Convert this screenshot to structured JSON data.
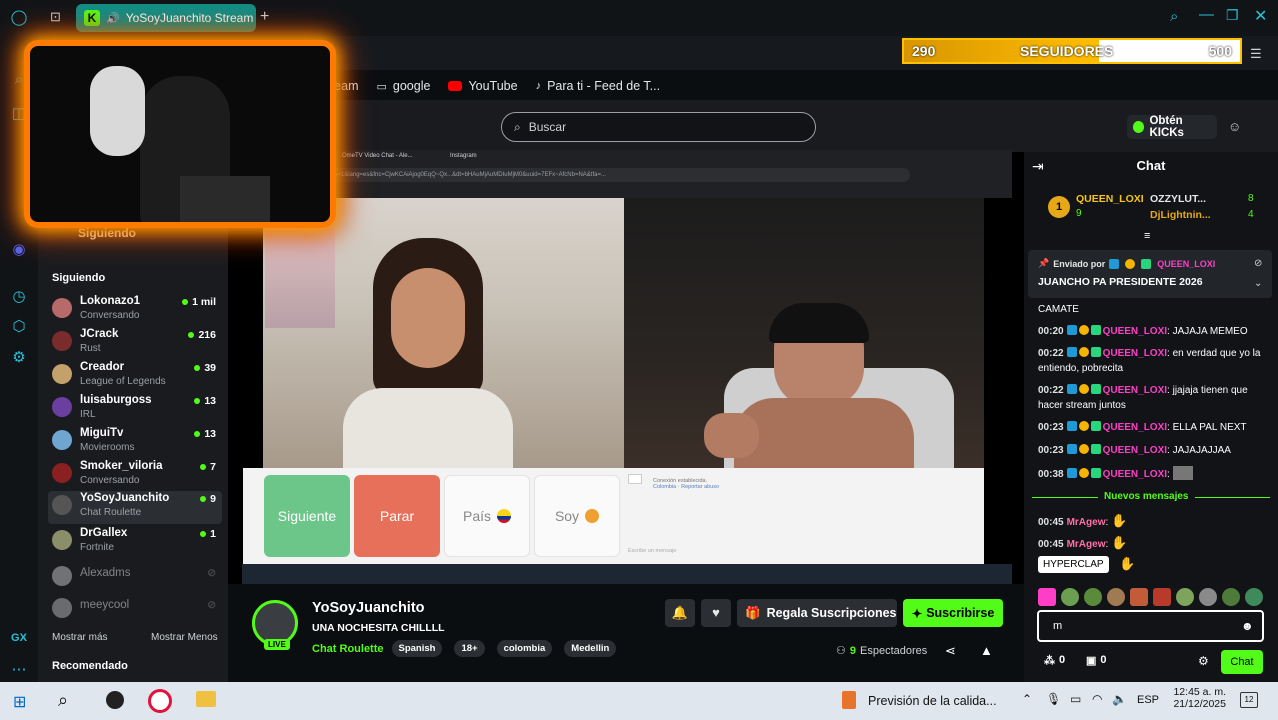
{
  "browser": {
    "tab_title": "YoSoyJuanchito Stream",
    "bookmarks": [
      {
        "label": "ream",
        "icon": "stream-icon"
      },
      {
        "label": "google",
        "icon": "folder-icon"
      },
      {
        "label": "YouTube",
        "icon": "youtube-icon"
      },
      {
        "label": "Para ti - Feed de T...",
        "icon": "tiktok-icon"
      }
    ]
  },
  "header": {
    "search_placeholder": "Buscar",
    "kicks_label": "Obtén KICKs"
  },
  "follower_goal": {
    "current": "290",
    "label": "SEGUIDORES",
    "target": "500",
    "progress": 0.58
  },
  "sidebar": {
    "following_top_label": "Siguiendo",
    "section_title": "Siguiendo",
    "items": [
      {
        "name": "Lokonazo1",
        "sub": "Conversando",
        "count": "1 mil",
        "live": true,
        "color": "#b86a6a"
      },
      {
        "name": "JCrack",
        "sub": "Rust",
        "count": "216",
        "live": true,
        "color": "#7a2c2c"
      },
      {
        "name": "Creador",
        "sub": "League of Legends",
        "count": "39",
        "live": true,
        "color": "#c4a06a"
      },
      {
        "name": "luisaburgoss",
        "sub": "IRL",
        "count": "13",
        "live": true,
        "color": "#6a3fa0"
      },
      {
        "name": "MiguiTv",
        "sub": "Movierooms",
        "count": "13",
        "live": true,
        "color": "#6fa6d0"
      },
      {
        "name": "Smoker_viloria",
        "sub": "Conversando",
        "count": "7",
        "live": true,
        "color": "#8a2020"
      },
      {
        "name": "YoSoyJuanchito",
        "sub": "Chat Roulette",
        "count": "9",
        "live": true,
        "color": "#555"
      },
      {
        "name": "DrGallex",
        "sub": "Fortnite",
        "count": "1",
        "live": true,
        "color": "#8a8f6a"
      },
      {
        "name": "Alexadms",
        "sub": "",
        "count": "",
        "live": false,
        "color": "#ddd"
      },
      {
        "name": "meeycool",
        "sub": "",
        "count": "",
        "live": false,
        "color": "#ccc"
      }
    ],
    "show_more": "Mostrar más",
    "show_less": "Mostrar Menos",
    "recommended": "Recomendado"
  },
  "video_chat": {
    "inner_tab_1": "OmeTV Video Chat - Ale...",
    "inner_tab_2": "Instagram",
    "inner_url": "ome.tv/?ch=1&lang=es&fnc=CjwKCAiAjog0EqQ~Qx...&dt=bHAuMjAuMDIuMjM0&uuid=7EFx~AfcNb=NA&tfa=...",
    "buttons": {
      "next": "Siguiente",
      "stop": "Parar",
      "country": "País",
      "me": "Soy"
    },
    "conn_text": "Conexión establecida.",
    "conn_sub": "Colombia · Reportar abuso",
    "write_placeholder": "Escribe un mensaje"
  },
  "stream": {
    "channel": "YoSoyJuanchito",
    "title": "UNA NOCHESITA CHILLLL",
    "category": "Chat Roulette",
    "tags": [
      "Spanish",
      "18+",
      "colombia",
      "Medellin"
    ],
    "live_badge": "LIVE",
    "viewers": "9",
    "viewers_label": "Espectadores",
    "gift_label": "Regala Suscripciones",
    "subscribe_label": "Suscribirse"
  },
  "chat": {
    "title": "Chat",
    "leaderboard": [
      {
        "rank": "1",
        "user": "QUEEN_LOXI",
        "score": "9"
      },
      {
        "user": "OZZYLUT...",
        "score": "8"
      },
      {
        "user": "DjLightnin...",
        "score": "4"
      }
    ],
    "pinned_by": "Enviado por",
    "pinned_user": "QUEEN_LOXI",
    "pinned_message": "JUANCHO PA PRESIDENTE 2026",
    "overflow_line": "CAMATE",
    "messages": [
      {
        "time": "00:20",
        "user": "QUEEN_LOXI",
        "text": "JAJAJA MEMEO"
      },
      {
        "time": "00:22",
        "user": "QUEEN_LOXI",
        "text": "en verdad que yo la entiendo, pobrecita"
      },
      {
        "time": "00:22",
        "user": "QUEEN_LOXI",
        "text": "jjajaja tienen que hacer stream juntos"
      },
      {
        "time": "00:23",
        "user": "QUEEN_LOXI",
        "text": "ELLA PAL NEXT"
      },
      {
        "time": "00:23",
        "user": "QUEEN_LOXI",
        "text": "JAJAJAJJAA"
      },
      {
        "time": "00:38",
        "user": "QUEEN_LOXI",
        "text": ""
      }
    ],
    "new_messages_label": "Nuevos mensajes",
    "new_messages": [
      {
        "time": "00:45",
        "user": "MrAgew",
        "text": ""
      },
      {
        "time": "00:45",
        "user": "MrAgew",
        "text": ""
      }
    ],
    "emote_tooltip": "HYPERCLAP",
    "input_value": "m",
    "kicks_count": "0",
    "gifts_count": "0",
    "send_label": "Chat"
  },
  "windows": {
    "weather": "Previsión de la calida...",
    "lang": "ESP",
    "time": "12:45 a. m.",
    "date": "21/12/2025",
    "notif_count": "12"
  }
}
